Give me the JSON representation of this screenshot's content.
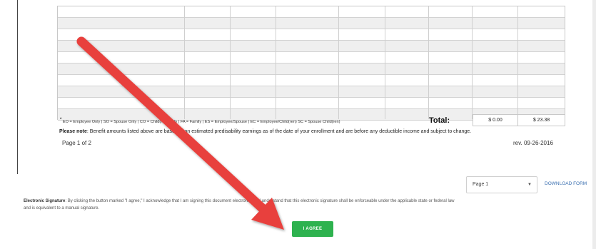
{
  "legend": {
    "marker": "*",
    "text": "EO = Employee Only | SO = Spouse Only | CO = Child(ren) Only | FA = Family | ES = Employee/Spouse | EC = Employee/Child(ren) SC = Spouse Child(ren)"
  },
  "totals": {
    "label": "Total:",
    "col1": "$ 0.00",
    "col2": "$ 23.38"
  },
  "note": {
    "label": "Please note",
    "text": ": Benefit amounts listed above are based upon estimated predisability earnings as of the date of your enrollment and are before any deductible income and subject to change."
  },
  "page_indicator": "Page 1 of 2",
  "revision": "rev. 09-26-2016",
  "page_select": {
    "value": "Page 1",
    "caret": "▼"
  },
  "download_link": "DOWNLOAD FORM",
  "esignature": {
    "label": "Electronic Signature",
    "line1": ": By clicking the button marked \"I agree,\" I acknowledge that I am signing this document electronically. I understand that this electronic signature shall be enforceable under the applicable state or federal law",
    "line2": "and is equivalent to a manual signature."
  },
  "agree_button": "I AGREE",
  "colors": {
    "agree": "#2eb24f",
    "arrow": "#e8413c",
    "link": "#3a6fb0"
  },
  "icons": {
    "annotation": "red-arrow-icon",
    "dropdown": "caret-down-icon"
  }
}
